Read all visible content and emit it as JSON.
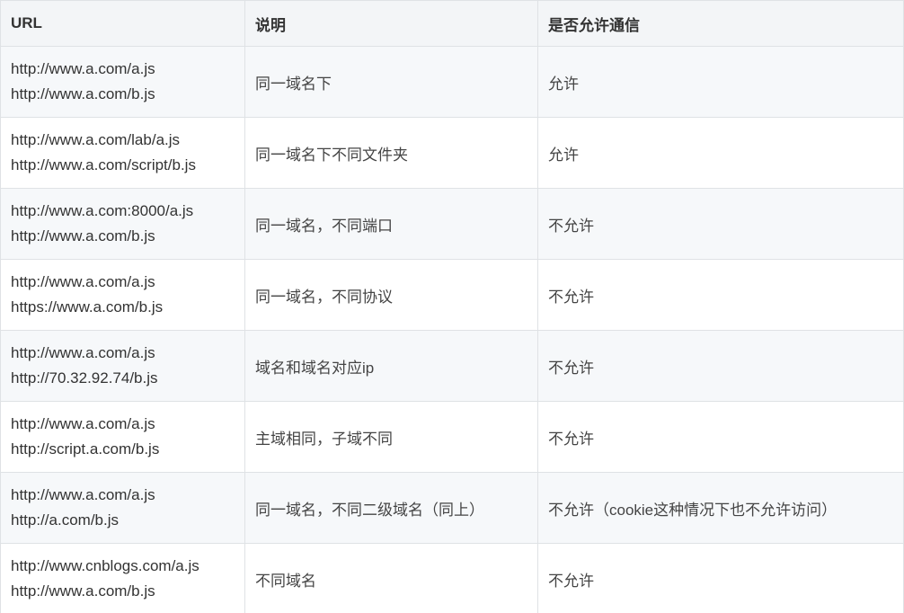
{
  "table": {
    "headers": {
      "url": "URL",
      "description": "说明",
      "allowed": "是否允许通信"
    },
    "rows": [
      {
        "url1": "http://www.a.com/a.js",
        "url2": "http://www.a.com/b.js",
        "description": "同一域名下",
        "allowed": "允许"
      },
      {
        "url1": "http://www.a.com/lab/a.js",
        "url2": "http://www.a.com/script/b.js",
        "description": "同一域名下不同文件夹",
        "allowed": "允许"
      },
      {
        "url1": "http://www.a.com:8000/a.js",
        "url2": "http://www.a.com/b.js",
        "description": "同一域名，不同端口",
        "allowed": "不允许"
      },
      {
        "url1": "http://www.a.com/a.js",
        "url2": "https://www.a.com/b.js",
        "description": "同一域名，不同协议",
        "allowed": "不允许"
      },
      {
        "url1": "http://www.a.com/a.js",
        "url2": "http://70.32.92.74/b.js",
        "description": "域名和域名对应ip",
        "allowed": "不允许"
      },
      {
        "url1": "http://www.a.com/a.js",
        "url2": "http://script.a.com/b.js",
        "description": "主域相同，子域不同",
        "allowed": "不允许"
      },
      {
        "url1": "http://www.a.com/a.js",
        "url2": "http://a.com/b.js",
        "description": "同一域名，不同二级域名（同上）",
        "allowed": "不允许（cookie这种情况下也不允许访问）"
      },
      {
        "url1": "http://www.cnblogs.com/a.js",
        "url2": "http://www.a.com/b.js",
        "description": "不同域名",
        "allowed": "不允许"
      }
    ]
  }
}
